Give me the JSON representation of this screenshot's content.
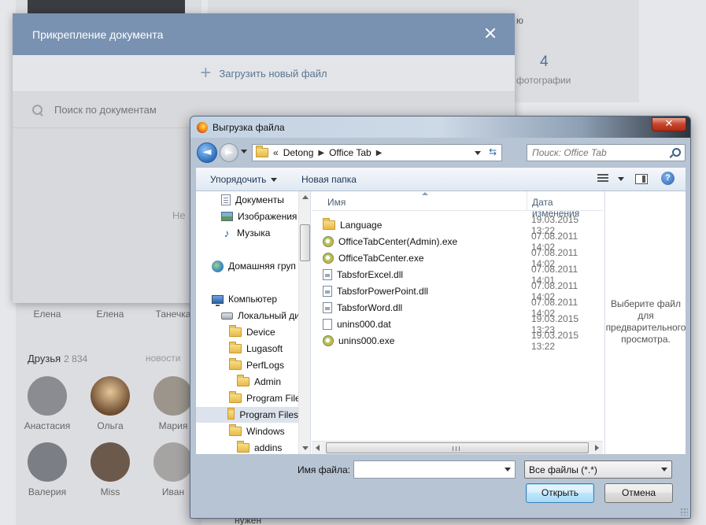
{
  "background": {
    "top_stub": "ю",
    "stat_count": "4",
    "stat_label": "фотографии",
    "empty_stub": "Не",
    "bottom_stub": "нужен",
    "friends_row1": [
      {
        "name": "Елена"
      },
      {
        "name": "Елена"
      },
      {
        "name": "Танечка"
      }
    ],
    "friends_header": {
      "label": "Друзья",
      "count": "2 834",
      "news": "новости"
    },
    "friends_row2": [
      {
        "name": "Анастасия"
      },
      {
        "name": "Ольга"
      },
      {
        "name": "Мария"
      }
    ],
    "friends_row3": [
      {
        "name": "Валерия"
      },
      {
        "name": "Miss"
      },
      {
        "name": "Иван"
      }
    ]
  },
  "vk_modal": {
    "title": "Прикрепление документа",
    "upload_label": "Загрузить новый файл",
    "search_placeholder": "Поиск по документам"
  },
  "dialog": {
    "title": "Выгрузка файла",
    "breadcrumbs": [
      "Detong",
      "Office Tab"
    ],
    "breadcrumb_prefix": "«",
    "search_placeholder": "Поиск: Office Tab",
    "toolbar": {
      "organize": "Упорядочить",
      "new_folder": "Новая папка"
    },
    "nav_items": [
      {
        "label": "Документы",
        "icon": "documents-icon"
      },
      {
        "label": "Изображения",
        "icon": "pictures-icon"
      },
      {
        "label": "Музыка",
        "icon": "music-icon"
      },
      {
        "label": "Домашняя груп",
        "icon": "homegroup-icon"
      },
      {
        "label": "Компьютер",
        "icon": "computer-icon"
      },
      {
        "label": "Локальный ди",
        "icon": "local-disk-icon"
      },
      {
        "label": "Device",
        "icon": "folder-icon"
      },
      {
        "label": "Lugasoft",
        "icon": "folder-icon"
      },
      {
        "label": "PerfLogs",
        "icon": "folder-icon"
      },
      {
        "label": "Admin",
        "icon": "locked-folder-icon"
      },
      {
        "label": "Program Files",
        "icon": "folder-icon"
      },
      {
        "label": "Program Files",
        "icon": "folder-icon"
      },
      {
        "label": "Windows",
        "icon": "folder-icon"
      },
      {
        "label": "addins",
        "icon": "folder-icon"
      }
    ],
    "columns": {
      "name": "Имя",
      "date": "Дата изменения"
    },
    "files": [
      {
        "name": "Language",
        "date": "19.03.2015 13:22",
        "icon": "folder-icon"
      },
      {
        "name": "OfficeTabCenter(Admin).exe",
        "date": "07.08.2011 14:02",
        "icon": "exe-icon"
      },
      {
        "name": "OfficeTabCenter.exe",
        "date": "07.08.2011 14:02",
        "icon": "exe-icon"
      },
      {
        "name": "TabsforExcel.dll",
        "date": "07.08.2011 14:01",
        "icon": "dll-icon"
      },
      {
        "name": "TabsforPowerPoint.dll",
        "date": "07.08.2011 14:02",
        "icon": "dll-icon"
      },
      {
        "name": "TabsforWord.dll",
        "date": "07.08.2011 14:02",
        "icon": "dll-icon"
      },
      {
        "name": "unins000.dat",
        "date": "19.03.2015 13:23",
        "icon": "dat-icon"
      },
      {
        "name": "unins000.exe",
        "date": "19.03.2015 13:22",
        "icon": "exe-icon"
      }
    ],
    "preview_text": "Выберите файл для предварительного просмотра.",
    "filename_label": "Имя файла:",
    "filename_value": "",
    "filter_value": "Все файлы (*.*)",
    "open_label": "Открыть",
    "cancel_label": "Отмена",
    "close_label": "✕"
  }
}
